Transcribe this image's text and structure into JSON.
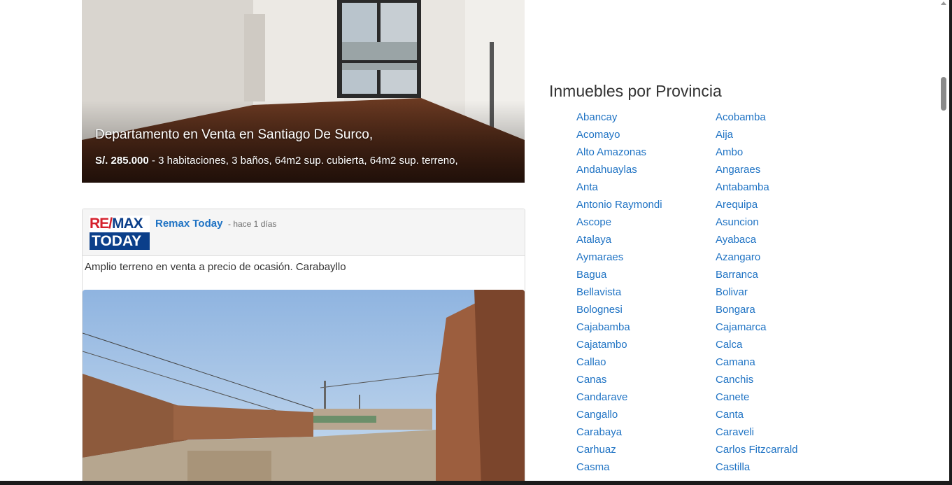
{
  "listing": {
    "title": "Departamento en Venta en Santiago De Surco,",
    "price": "S/. 285.000",
    "details": " - 3 habitaciones, 3 baños, 64m2 sup. cubierta, 64m2 sup. terreno,"
  },
  "post": {
    "logo_top_a": "RE/",
    "logo_top_b": "MAX",
    "logo_bottom": "TODAY",
    "author": "Remax Today",
    "time": "- hace 1 días",
    "text": "Amplio terreno en venta a precio de ocasión. Carabayllo"
  },
  "provinces": {
    "heading": "Inmuebles por Provincia",
    "left": [
      "Abancay",
      "Acomayo",
      "Alto Amazonas",
      "Andahuaylas",
      "Anta",
      "Antonio Raymondi",
      "Ascope",
      "Atalaya",
      "Aymaraes",
      "Bagua",
      "Bellavista",
      "Bolognesi",
      "Cajabamba",
      "Cajatambo",
      "Callao",
      "Canas",
      "Candarave",
      "Cangallo",
      "Carabaya",
      "Carhuaz",
      "Casma"
    ],
    "right": [
      "Acobamba",
      "Aija",
      "Ambo",
      "Angaraes",
      "Antabamba",
      "Arequipa",
      "Asuncion",
      "Ayabaca",
      "Azangaro",
      "Barranca",
      "Bolivar",
      "Bongara",
      "Cajamarca",
      "Calca",
      "Camana",
      "Canchis",
      "Canete",
      "Canta",
      "Caraveli",
      "Carlos Fitzcarrald",
      "Castilla"
    ]
  },
  "colors": {
    "link": "#1f73c4",
    "remax_red": "#d5202c",
    "remax_blue": "#0b3f8a"
  }
}
